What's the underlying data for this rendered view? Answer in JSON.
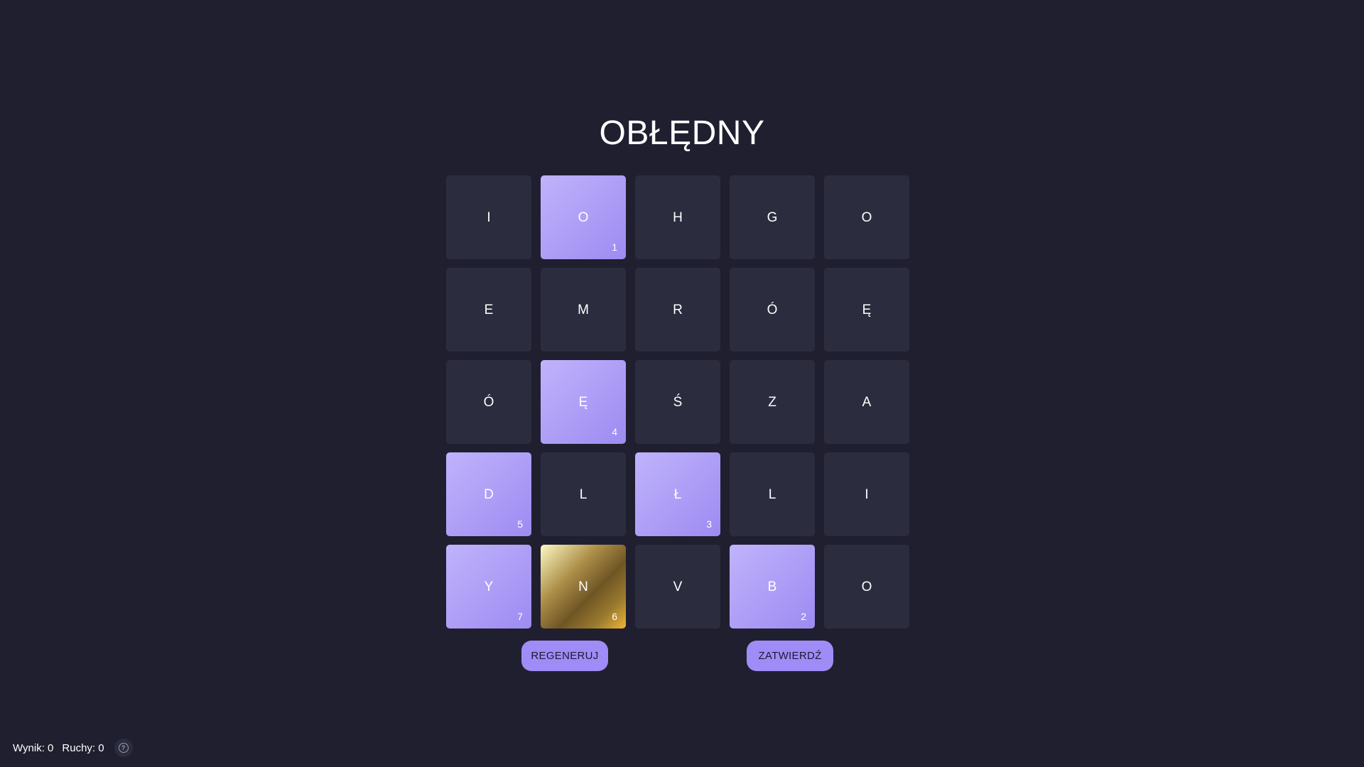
{
  "game": {
    "title": "OBŁĘDNY"
  },
  "board": {
    "rows": [
      [
        {
          "letter": "I",
          "order": ""
        },
        {
          "letter": "O",
          "order": "1",
          "state": "selected"
        },
        {
          "letter": "H",
          "order": ""
        },
        {
          "letter": "G",
          "order": ""
        },
        {
          "letter": "O",
          "order": ""
        }
      ],
      [
        {
          "letter": "E",
          "order": ""
        },
        {
          "letter": "M",
          "order": ""
        },
        {
          "letter": "R",
          "order": ""
        },
        {
          "letter": "Ó",
          "order": ""
        },
        {
          "letter": "Ę",
          "order": ""
        }
      ],
      [
        {
          "letter": "Ó",
          "order": ""
        },
        {
          "letter": "Ę",
          "order": "4",
          "state": "selected"
        },
        {
          "letter": "Ś",
          "order": ""
        },
        {
          "letter": "Z",
          "order": ""
        },
        {
          "letter": "A",
          "order": ""
        }
      ],
      [
        {
          "letter": "D",
          "order": "5",
          "state": "selected"
        },
        {
          "letter": "L",
          "order": ""
        },
        {
          "letter": "Ł",
          "order": "3",
          "state": "selected"
        },
        {
          "letter": "L",
          "order": ""
        },
        {
          "letter": "I",
          "order": ""
        }
      ],
      [
        {
          "letter": "Y",
          "order": "7",
          "state": "selected"
        },
        {
          "letter": "N",
          "order": "6",
          "state": "gold"
        },
        {
          "letter": "V",
          "order": ""
        },
        {
          "letter": "B",
          "order": "2",
          "state": "selected"
        },
        {
          "letter": "O",
          "order": ""
        }
      ]
    ]
  },
  "controls": {
    "regenerate_label": "REGENERUJ",
    "submit_label": "ZATWIERDŹ"
  },
  "status": {
    "score_text": "Wynik: 0",
    "moves_text": "Ruchy: 0",
    "help_glyph": "?",
    "help_icon": "help-circle-icon"
  },
  "colors": {
    "background": "#1f1f30",
    "tile": "#2c2c3f",
    "tile_selected": "#a999f6",
    "tile_special": "#b8953a",
    "button": "#9f8cf7"
  }
}
